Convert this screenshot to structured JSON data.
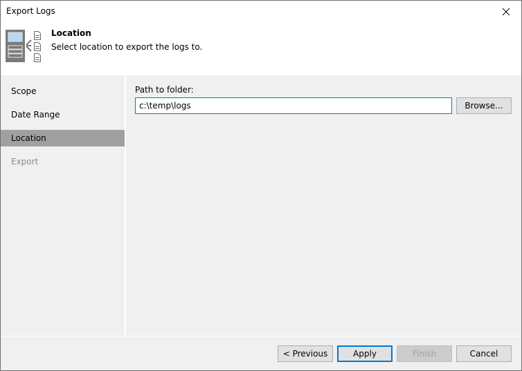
{
  "window": {
    "title": "Export Logs",
    "close_icon": "close-icon"
  },
  "header": {
    "title": "Location",
    "subtitle": "Select location to export the logs to.",
    "icon": "export-logs-icon"
  },
  "sidebar": {
    "items": [
      {
        "label": "Scope",
        "state": "normal"
      },
      {
        "label": "Date Range",
        "state": "normal"
      },
      {
        "label": "Location",
        "state": "active"
      },
      {
        "label": "Export",
        "state": "disabled"
      }
    ]
  },
  "content": {
    "path_label": "Path to folder:",
    "path_value": "c:\\temp\\logs",
    "browse_label": "Browse..."
  },
  "footer": {
    "previous_label": "< Previous",
    "apply_label": "Apply",
    "finish_label": "Finish",
    "cancel_label": "Cancel"
  },
  "colors": {
    "accent": "#0078d7",
    "active_nav": "#a0a0a0",
    "panel_bg": "#f0f0f0"
  }
}
